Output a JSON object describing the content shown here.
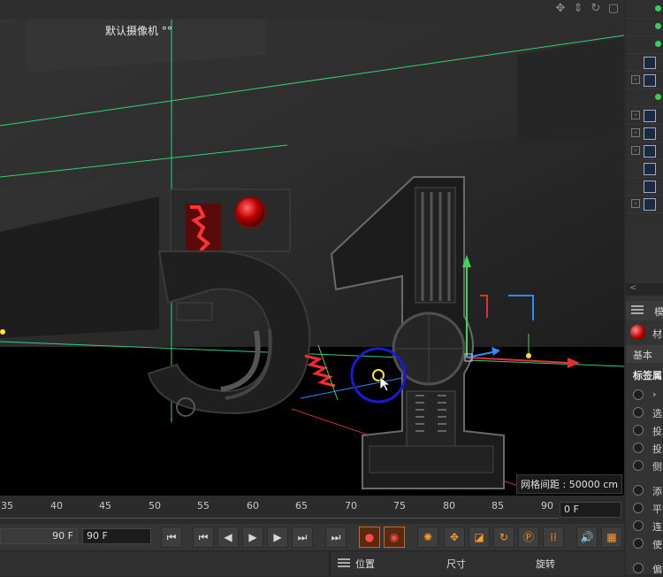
{
  "viewport": {
    "camera_label": "默认摄像机",
    "camera_icon": "camera-dots-icon",
    "grid_spacing": "网格间距 : 50000 cm"
  },
  "nav_icons": [
    "move-view-icon",
    "zoom-view-icon",
    "rotate-view-icon",
    "maximize-view-icon"
  ],
  "timeline": {
    "ticks": [
      "35",
      "40",
      "45",
      "50",
      "55",
      "60",
      "65",
      "70",
      "75",
      "80",
      "85",
      "90"
    ],
    "current_frame": "0 F"
  },
  "transport": {
    "end_frame": "90 F",
    "max_frame": "90 F",
    "buttons": [
      {
        "name": "go-to-start-button",
        "glyph": "⏮"
      },
      {
        "name": "prev-keyframe-button",
        "glyph": "⏮"
      },
      {
        "name": "prev-frame-button",
        "glyph": "◀"
      },
      {
        "name": "play-button",
        "glyph": "▶"
      },
      {
        "name": "next-frame-button",
        "glyph": "▶"
      },
      {
        "name": "next-keyframe-button",
        "glyph": "⏭"
      },
      {
        "name": "go-to-end-button",
        "glyph": "⏭"
      }
    ]
  },
  "coord_manager": {
    "position": "位置",
    "size": "尺寸",
    "rotation": "旋转"
  },
  "attributes": {
    "header": "模",
    "material": "材",
    "tab": "基本",
    "section_title": "标签属",
    "props": [
      "›",
      "选",
      "投",
      "投",
      "侧",
      "添",
      "平",
      "连",
      "使",
      "偏"
    ]
  },
  "colors": {
    "viewport_bg": "#0c0c0c",
    "panel_bg": "#2b2b2b",
    "green_axis": "#3cd65a",
    "red_axis": "#e03030",
    "blue_axis": "#2a8cff",
    "selection_circle": "#1a1ad6"
  }
}
